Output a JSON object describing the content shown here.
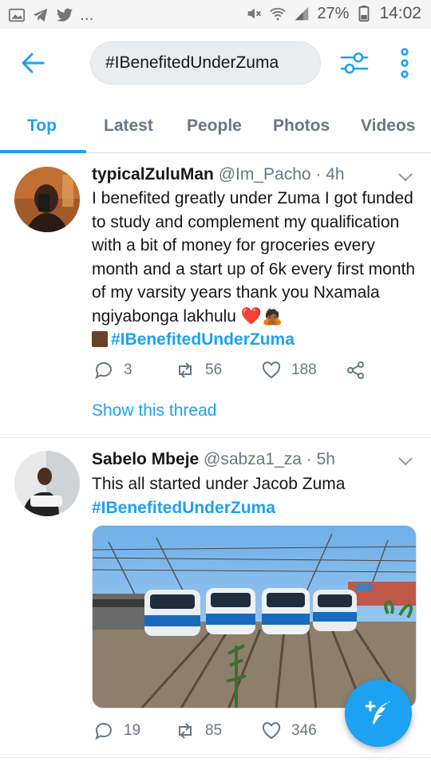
{
  "status_bar": {
    "battery_percent": "27%",
    "time": "14:02",
    "more_indicator": "..."
  },
  "header": {
    "search_value": "#IBenefitedUnderZuma"
  },
  "tabs": [
    {
      "label": "Top",
      "active": true
    },
    {
      "label": "Latest",
      "active": false
    },
    {
      "label": "People",
      "active": false
    },
    {
      "label": "Photos",
      "active": false
    },
    {
      "label": "Videos",
      "active": false
    }
  ],
  "tweets": [
    {
      "name": "typicalZuluMan",
      "handle": "@Im_Pacho",
      "time": "· 4h",
      "text": "I benefited greatly under Zuma I got funded to study and complement my qualification with a bit of money for groceries every month and a start up of 6k every first month of my varsity years thank you Nxamala ngiyabonga lakhulu ❤️🙇🏾",
      "hashtag": "#IBenefitedUnderZuma",
      "replies": "3",
      "retweets": "56",
      "likes": "188",
      "show_thread": "Show this thread"
    },
    {
      "name": "Sabelo Mbeje",
      "handle": "@sabza1_za",
      "time": "· 5h",
      "text": "This all started under Jacob Zuma",
      "hashtag": "#IBenefitedUnderZuma",
      "replies": "19",
      "retweets": "85",
      "likes": "346"
    }
  ],
  "colors": {
    "accent": "#1da1f2",
    "muted": "#657786",
    "text": "#14171a"
  },
  "icons": {
    "back": "arrow-left-icon",
    "filter": "sliders-icon",
    "more": "vertical-dots-icon",
    "compose": "compose-feather-icon"
  }
}
